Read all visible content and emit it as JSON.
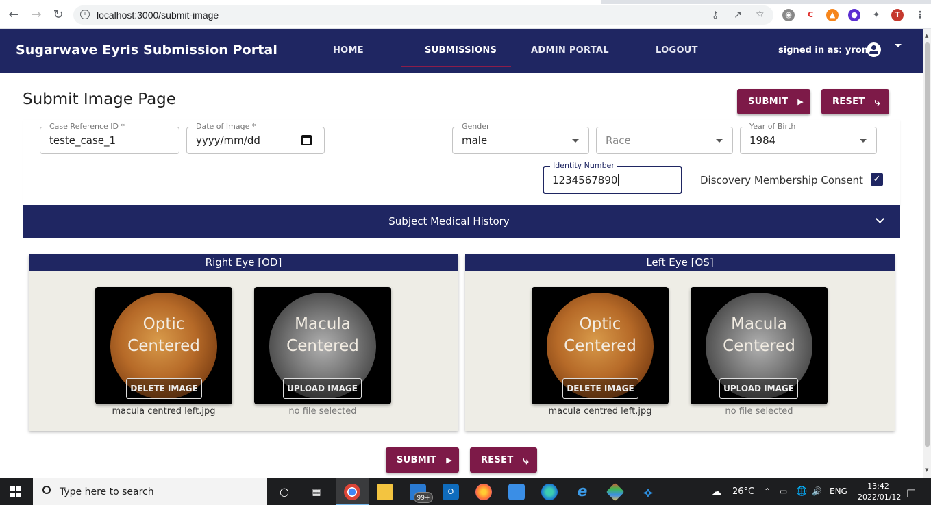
{
  "browser": {
    "url": "localhost:3000/submit-image",
    "profile_initial": "T"
  },
  "header": {
    "app_title": "Sugarwave Eyris Submission Portal",
    "nav": [
      "HOME",
      "SUBMISSIONS",
      "ADMIN PORTAL",
      "LOGOUT"
    ],
    "active_nav": "SUBMISSIONS",
    "signed_in": "signed in as: yron"
  },
  "page": {
    "title": "Submit Image Page",
    "submit_label": "SUBMIT",
    "reset_label": "RESET"
  },
  "form": {
    "case_ref": {
      "label": "Case Reference ID *",
      "value": "teste_case_1"
    },
    "date": {
      "label": "Date of Image *",
      "value": "yyyy/mm/dd"
    },
    "gender": {
      "label": "Gender",
      "value": "male"
    },
    "race": {
      "placeholder": "Race"
    },
    "yob": {
      "label": "Year of Birth",
      "value": "1984"
    },
    "identity": {
      "label": "Identity Number",
      "value": "1234567890"
    },
    "consent_label": "Discovery Membership Consent",
    "consent_checked": true
  },
  "accordion": {
    "title": "Subject Medical History"
  },
  "eyes": {
    "right": {
      "title": "Right Eye [OD]",
      "optic": {
        "line1": "Optic",
        "line2": "Centered",
        "button": "DELETE IMAGE",
        "file": "macula centred left.jpg"
      },
      "macula": {
        "line1": "Macula",
        "line2": "Centered",
        "button": "UPLOAD IMAGE",
        "file": "no file selected"
      }
    },
    "left": {
      "title": "Left Eye [OS]",
      "optic": {
        "line1": "Optic",
        "line2": "Centered",
        "button": "DELETE IMAGE",
        "file": "macula centred left.jpg"
      },
      "macula": {
        "line1": "Macula",
        "line2": "Centered",
        "button": "UPLOAD IMAGE",
        "file": "no file selected"
      }
    }
  },
  "taskbar": {
    "search_placeholder": "Type here to search",
    "mail_badge": "99+",
    "weather": "26°C",
    "lang": "ENG",
    "time": "13:42",
    "date": "2022/01/12"
  },
  "colors": {
    "header_navy": "#1f2662",
    "accent_maroon": "#7d1a48"
  }
}
